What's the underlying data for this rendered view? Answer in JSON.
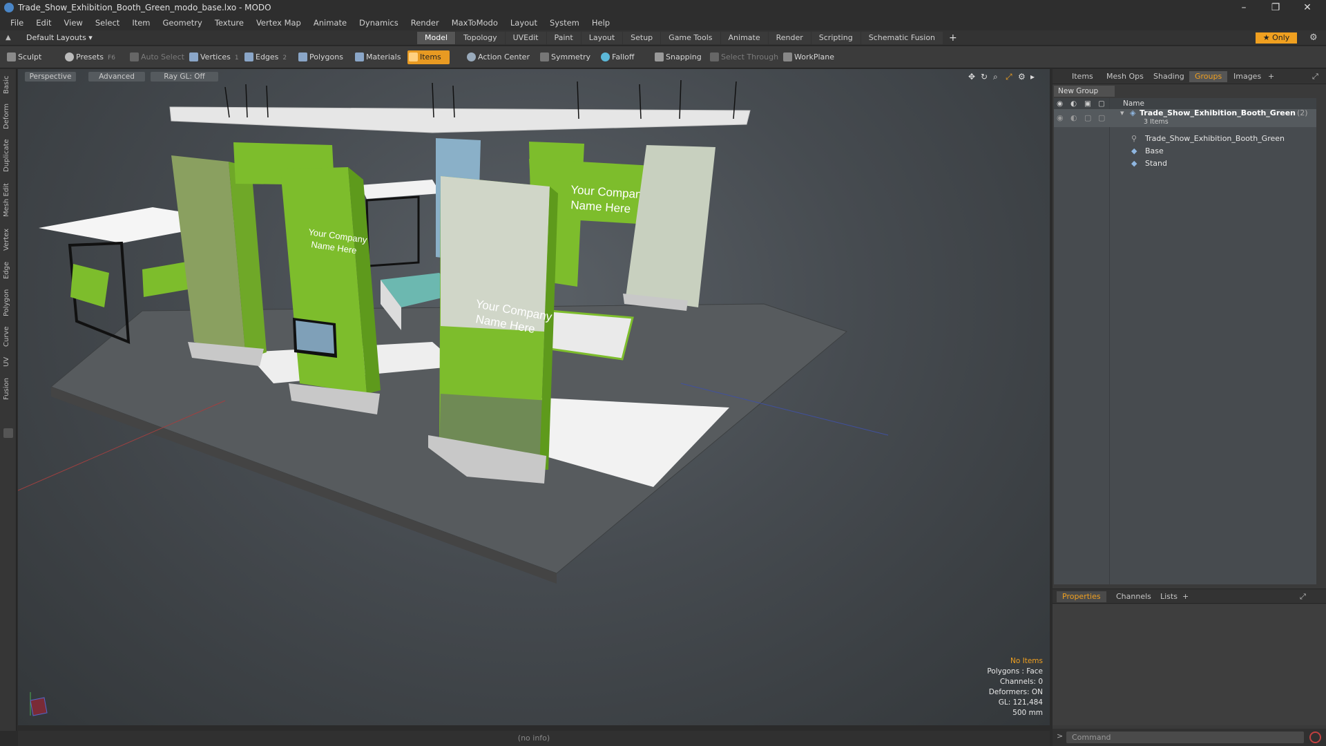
{
  "window": {
    "title": "Trade_Show_Exhibition_Booth_Green_modo_base.lxo - MODO",
    "controls": {
      "minimize": "–",
      "restore": "❐",
      "close": "✕"
    }
  },
  "menu": [
    "File",
    "Edit",
    "View",
    "Select",
    "Item",
    "Geometry",
    "Texture",
    "Vertex Map",
    "Animate",
    "Dynamics",
    "Render",
    "MaxToModo",
    "Layout",
    "System",
    "Help"
  ],
  "layouts": {
    "selector": "Default Layouts ▾",
    "tabs": [
      "Model",
      "Topology",
      "UVEdit",
      "Paint",
      "Layout",
      "Setup",
      "Game Tools",
      "Animate",
      "Render",
      "Scripting",
      "Schematic Fusion"
    ],
    "active_tab": "Model",
    "add": "+",
    "only_label": "★  Only"
  },
  "toolbar": {
    "sculpt": "Sculpt",
    "presets": "Presets",
    "presets_key": "F6",
    "auto_select": "Auto Select",
    "vertices": "Vertices",
    "vertices_key": "1",
    "edges": "Edges",
    "edges_key": "2",
    "polygons": "Polygons",
    "materials": "Materials",
    "items": "Items",
    "action_center": "Action Center",
    "symmetry": "Symmetry",
    "falloff": "Falloff",
    "snapping": "Snapping",
    "select_through": "Select Through",
    "workplane": "WorkPlane"
  },
  "left_tabs": [
    "Basic",
    "Deform",
    "Duplicate",
    "Mesh Edit",
    "Vertex",
    "Edge",
    "Polygon",
    "Curve",
    "UV",
    "Fusion"
  ],
  "viewport": {
    "view_mode": "Perspective",
    "shading": "Advanced",
    "raygl": "Ray GL: Off",
    "status": {
      "selection": "No Items",
      "polygons": "Polygons : Face",
      "channels": "Channels: 0",
      "deformers": "Deformers: ON",
      "gl": "GL: 121,484",
      "scale": "500 mm"
    },
    "banner_text_1": "Your Company",
    "banner_text_2": "Name Here"
  },
  "info_bar": "(no info)",
  "right_panel": {
    "tabs": [
      "Items",
      "Mesh Ops",
      "Shading",
      "Groups",
      "Images"
    ],
    "active_tab": "Groups",
    "add": "+",
    "new_group": "New Group",
    "column_name": "Name",
    "tree": {
      "group_name": "Trade_Show_Exhibition_Booth_Green",
      "group_count": "(2)",
      "group_sub": "3 Items",
      "children": [
        "Trade_Show_Exhibition_Booth_Green",
        "Base",
        "Stand"
      ]
    },
    "bottom_tabs": [
      "Properties",
      "Channels",
      "Lists"
    ],
    "bottom_active": "Properties",
    "command_placeholder": "Command"
  },
  "colors": {
    "accent": "#f0a020",
    "banner_green": "#7dbd2c",
    "banner_green_dark": "#5e9a1c",
    "floor": "#555555"
  }
}
